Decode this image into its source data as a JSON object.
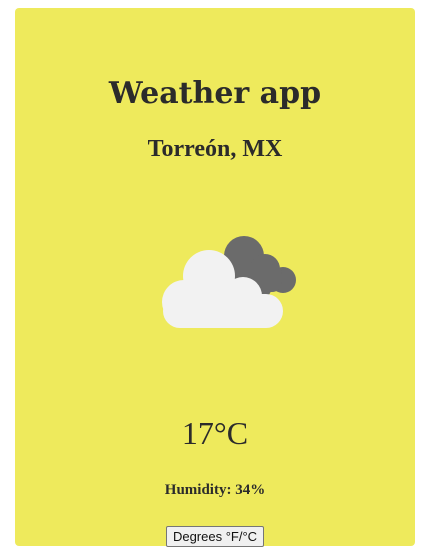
{
  "app": {
    "title": "Weather app"
  },
  "location": {
    "city": "Torreón, MX"
  },
  "weather": {
    "icon": "partly-cloudy-icon",
    "temperature": "17°C",
    "humidity": "Humidity: 34%"
  },
  "controls": {
    "toggle_label": "Degrees °F/°C"
  },
  "colors": {
    "card_background": "#eeea5c",
    "text": "#2b2b2b",
    "cloud_front": "#f2f2f2",
    "cloud_back": "#6b6b6b"
  }
}
